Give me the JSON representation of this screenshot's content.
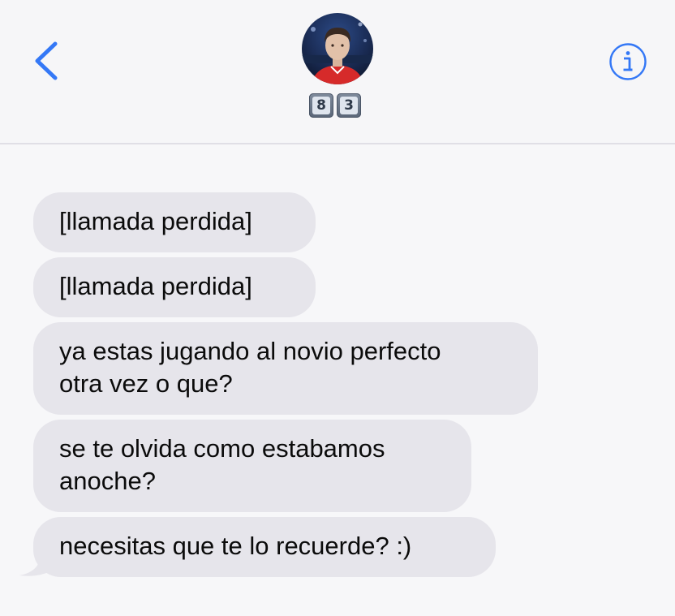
{
  "header": {
    "contact_name": [
      "8",
      "3"
    ],
    "back_icon": "chevron-left-icon",
    "info_icon": "info-circle-icon",
    "accent_color": "#3478f6"
  },
  "messages": [
    {
      "text": "[llamada perdida]"
    },
    {
      "text": "[llamada perdida]"
    },
    {
      "text": "ya estas jugando al novio perfecto\notra vez o que?"
    },
    {
      "text": "se te olvida como estabamos\nanoche?"
    },
    {
      "text": "necesitas que te lo recuerde? :)"
    }
  ],
  "colors": {
    "background": "#f7f7f9",
    "incoming_bubble": "#e6e5eb",
    "text": "#0b0b0b"
  }
}
